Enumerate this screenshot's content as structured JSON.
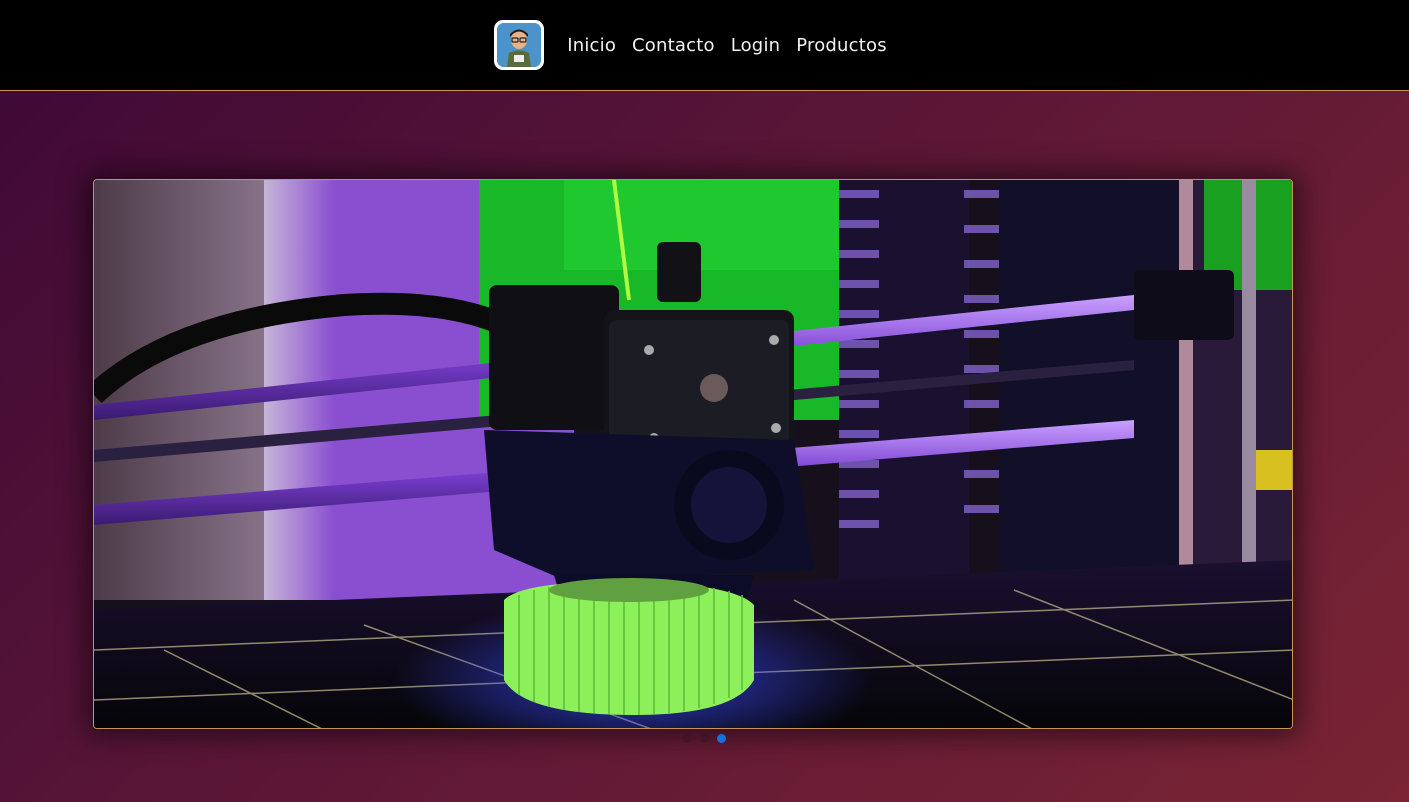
{
  "navbar": {
    "logo_alt": "logo avatar",
    "links": [
      "Inicio",
      "Contacto",
      "Login",
      "Productos"
    ]
  },
  "carousel": {
    "slide_count": 3,
    "active_index": 2,
    "image_alt": "3D printer extruder printing a green gear"
  },
  "colors": {
    "nav_bg": "#000000",
    "accent_border": "#c9935a",
    "active_dot": "#1a6fe0"
  }
}
